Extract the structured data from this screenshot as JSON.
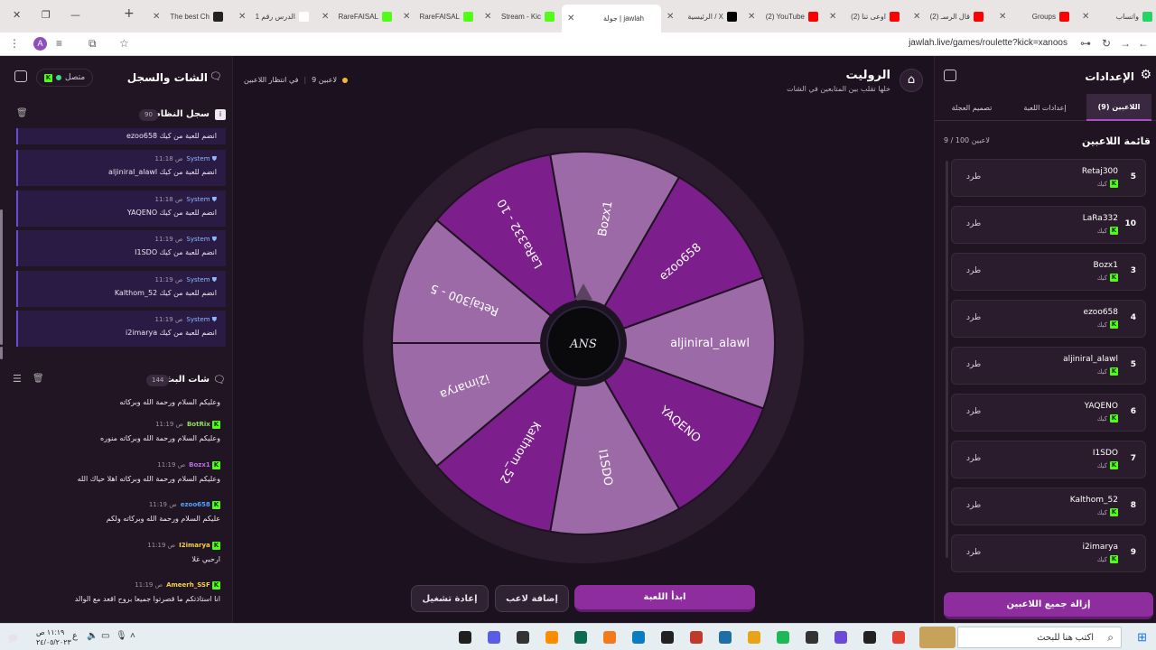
{
  "browser": {
    "tabs": [
      {
        "label": "واتساب",
        "color": "#25d366"
      },
      {
        "label": "Groups",
        "color": "#ff0000"
      },
      {
        "label": "(2) قال الرسـ",
        "color": "#ff0000"
      },
      {
        "label": "(2) اوعى تنا",
        "color": "#ff0000"
      },
      {
        "label": "(2) YouTube",
        "color": "#ff0000"
      },
      {
        "label": "الرئيسية / X",
        "color": "#000000"
      },
      {
        "label": "جولة | jawlah",
        "color": "#ffffff"
      },
      {
        "label": "Stream - Kic",
        "color": "#53fc18"
      },
      {
        "label": "RareFAISAL",
        "color": "#53fc18"
      },
      {
        "label": "RareFAISAL",
        "color": "#53fc18"
      },
      {
        "label": "الدرس رقم 1",
        "color": "#ffffff"
      },
      {
        "label": "The best Ch",
        "color": "#222222"
      }
    ],
    "url": "jawlah.live/games/roulette?kick=xanoos",
    "avatar_letter": "A"
  },
  "chat": {
    "title": "الشات والسجل",
    "status": "متصل",
    "system_log": {
      "title": "سجل النظام",
      "count": "90",
      "first_partial": "ezoo658 انضم للعبة من كيك",
      "messages": [
        {
          "user": "System",
          "time": "11:18 ص",
          "text": "aljiniral_alawl انضم للعبة من كيك"
        },
        {
          "user": "System",
          "time": "11:18 ص",
          "text": "YAQENO انضم للعبة من كيك"
        },
        {
          "user": "System",
          "time": "11:19 ص",
          "text": "I1SDO انضم للعبة من كيك"
        },
        {
          "user": "System",
          "time": "11:19 ص",
          "text": "Kalthom_52 انضم للعبة من كيك"
        },
        {
          "user": "System",
          "time": "11:19 ص",
          "text": "i2imarya انضم للعبة من كيك"
        }
      ]
    },
    "stream_chat": {
      "title": "شات البث",
      "count": "144",
      "first_partial": "وعليكم السلام ورحمة الله وبركاته",
      "messages": [
        {
          "user": "BotRix",
          "color": "#8ee05a",
          "time": "11:19 ص",
          "text": "وعليكم السلام ورحمة الله وبركاته منوره"
        },
        {
          "user": "Bozx1",
          "color": "#b76de8",
          "time": "11:19 ص",
          "text": "وعليكم السلام ورحمة الله وبركاته اهلا حياك الله"
        },
        {
          "user": "ezoo658",
          "color": "#4da3ff",
          "time": "11:19 ص",
          "text": "عليكم السلام ورحمة الله وبركاته ولكم"
        },
        {
          "user": "I2imarya",
          "color": "#f2d14b",
          "time": "11:19 ص",
          "text": "ارحبي غلا"
        },
        {
          "user": "Ameerh_SSF",
          "color": "#f2d14b",
          "time": "11:19 ص",
          "text": "انا استاذتكم ما قصرتوا جميعا بروح اقعد مع الوالد"
        }
      ]
    }
  },
  "game": {
    "title": "الروليت",
    "subtitle": "خلها تقلب بين المتابعين في الشات",
    "players_count": "9 لاعبين",
    "waiting": "في انتظار اللاعبين",
    "hub_logo": "ANS",
    "wheel_segments": [
      {
        "label": "Bozx1",
        "color": "#9d6aa8"
      },
      {
        "label": "ezoo658",
        "color": "#7c1e8c"
      },
      {
        "label": "aljiniral_alawl",
        "color": "#9d6aa8"
      },
      {
        "label": "YAQENO",
        "color": "#7c1e8c"
      },
      {
        "label": "I1SDO",
        "color": "#9d6aa8"
      },
      {
        "label": "Kalthom_52",
        "color": "#7c1e8c"
      },
      {
        "label": "i2imarya",
        "color": "#9d6aa8"
      },
      {
        "label": "Retaj300 - 5",
        "color": "#9d6aa8"
      },
      {
        "label": "LaRa332 - 10",
        "color": "#7c1e8c"
      }
    ],
    "buttons": {
      "start": "ابدأ اللعبة",
      "add": "إضافة لاعب",
      "restart": "إعادة تشغيل"
    }
  },
  "settings": {
    "title": "الإعدادات",
    "tabs": [
      "اللاعبين (9)",
      "إعدادات اللعبة",
      "تصميم العجلة"
    ],
    "list_title": "قائمة اللاعبين",
    "list_count": "9 / 100 لاعبين",
    "kick_label": "كيك",
    "remove_label": "طرد",
    "players": [
      {
        "name": "Retaj300",
        "num": "5"
      },
      {
        "name": "LaRa332",
        "num": "10"
      },
      {
        "name": "Bozx1",
        "num": "3"
      },
      {
        "name": "ezoo658",
        "num": "4"
      },
      {
        "name": "aljiniral_alawl",
        "num": "5"
      },
      {
        "name": "YAQENO",
        "num": "6"
      },
      {
        "name": "I1SDO",
        "num": "7"
      },
      {
        "name": "Kalthom_52",
        "num": "8"
      },
      {
        "name": "i2imarya",
        "num": "9"
      }
    ],
    "remove_all": "إزالة جميع اللاعبين"
  },
  "taskbar": {
    "search_placeholder": "اكتب هنا للبحث",
    "time": "١١:١٩ ص",
    "date": "٢٤/٠٥/٢٠٢٣",
    "lang": "ع"
  }
}
